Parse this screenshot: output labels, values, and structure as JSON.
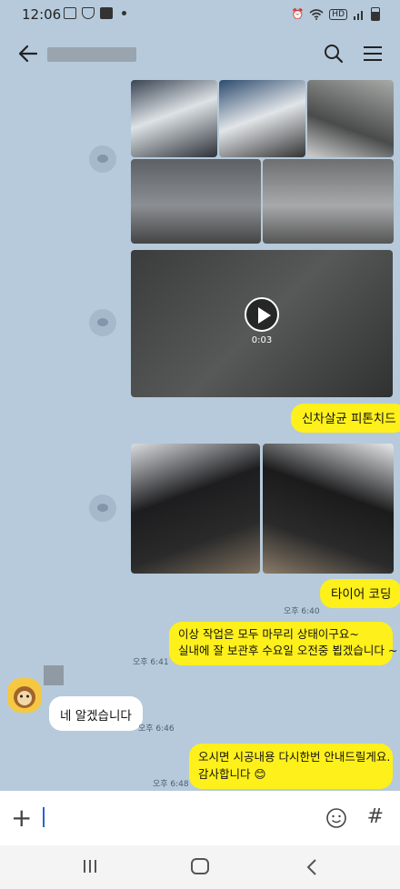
{
  "status_bar": {
    "time": "12:06",
    "network": "HD"
  },
  "chat": {
    "video": {
      "duration": "0:03"
    },
    "messages": [
      {
        "id": "m1",
        "text": "신차살균 피톤치드"
      },
      {
        "id": "m2",
        "text": "타이어 코딩",
        "time": "오후 6:40"
      },
      {
        "id": "m3",
        "lines": [
          "이상 작업은 모두 마무리 상태이구요~",
          "실내에 잘 보관후 수요일 오전중 뵙겠습니다 ~"
        ],
        "time": "오후 6:41"
      },
      {
        "id": "m4",
        "text": "네 알겠습니다",
        "time": "오후 6:46"
      },
      {
        "id": "m5",
        "lines": [
          "오시면 시공내용 다시한번 안내드릴게요.",
          "감사합니다 😊"
        ],
        "time": "오후 6:48"
      }
    ]
  },
  "colors": {
    "chat_bg": "#b6cadb",
    "my_bubble": "#fef01b",
    "other_bubble": "#ffffff"
  },
  "icons": [
    "back-arrow-icon",
    "search-icon",
    "menu-icon",
    "share-icon",
    "play-icon",
    "plus-icon",
    "emoji-icon",
    "hash-icon",
    "recent-apps-icon",
    "home-icon",
    "nav-back-icon"
  ]
}
